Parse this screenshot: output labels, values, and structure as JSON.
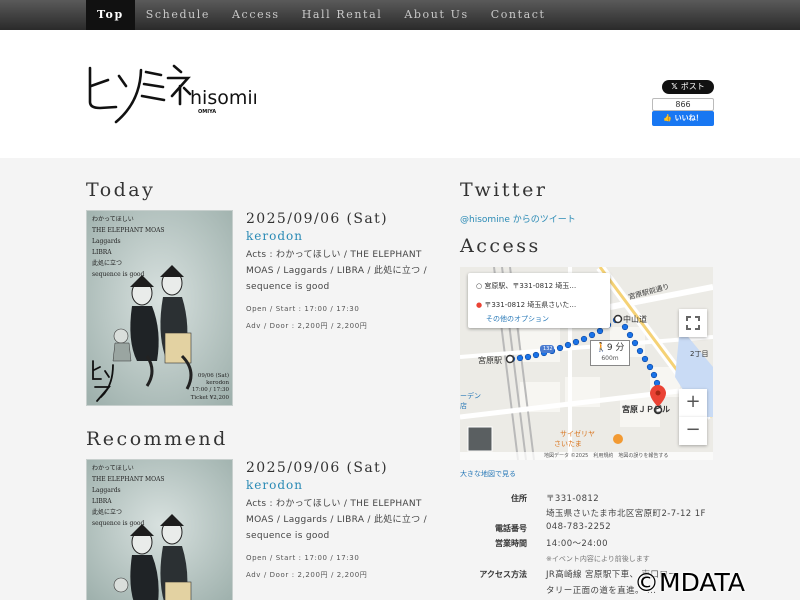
{
  "nav": {
    "items": [
      {
        "label": "Top",
        "active": true
      },
      {
        "label": "Schedule"
      },
      {
        "label": "Access"
      },
      {
        "label": "Hall Rental"
      },
      {
        "label": "About Us"
      },
      {
        "label": "Contact"
      }
    ]
  },
  "header": {
    "logo_text": "ヒソミネ",
    "logo_roman": "hisomine",
    "logo_sub": "OMIYA",
    "share_x_label": "ポスト",
    "fb_count": "866",
    "fb_like_label": "いいね！"
  },
  "today": {
    "title": "Today",
    "date": "2025/09/06 (Sat)",
    "name": "kerodon",
    "acts": "Acts : わかってほしい / THE ELEPHANT MOAS / Laggards / LIBRA / 此処に立つ / sequence is good",
    "open_start": "Open / Start : 17:00 / 17:30",
    "adv_door": "Adv / Door : 2,200円 / 2,200円",
    "flyer": {
      "lines": [
        "わかってほしい",
        "THE ELEPHANT MOAS",
        "Laggards",
        "LIBRA",
        "此処に立つ",
        "sequence is good"
      ],
      "footer": [
        "09/06 (Sat)",
        "kerodon",
        "17:00 / 17:30",
        "Ticket ¥2,200"
      ]
    }
  },
  "recommend": {
    "title": "Recommend",
    "date": "2025/09/06 (Sat)",
    "name": "kerodon",
    "acts": "Acts : わかってほしい / THE ELEPHANT MOAS / Laggards / LIBRA / 此処に立つ / sequence is good",
    "open_start": "Open / Start : 17:00 / 17:30",
    "adv_door": "Adv / Door : 2,200円 / 2,200円",
    "flyer": {
      "lines": [
        "わかってほしい",
        "THE ELEPHANT MOAS",
        "Laggards",
        "LIBRA",
        "此処に立つ",
        "sequence is good"
      ]
    }
  },
  "twitter": {
    "title": "Twitter",
    "link": "@hisomine からのツイート"
  },
  "access": {
    "title": "Access",
    "map": {
      "from": "宮原駅、〒331-0812 埼玉…",
      "to": "〒331-0812 埼玉県さいた…",
      "more_options": "その他のオプション",
      "walk_time": "9 分",
      "walk_distance": "600m",
      "labels": {
        "station": "宮原駅",
        "nakasendo": "中山道",
        "destination": "宮原ＪＰビル",
        "road": "宮原駅前通り",
        "chome": "2丁目",
        "saizeriya": "サイゼリヤ",
        "saizeriya2": "さいたま",
        "route_no": "132",
        "partial": "ーデン",
        "partial2": "店"
      },
      "zoom_in": "+",
      "zoom_out": "−",
      "footer": "地図データ ©2025　利用規約　地図の誤りを報告する"
    },
    "bigmap_link": "大きな地図で見る",
    "info": [
      {
        "label": "住所",
        "values": [
          "〒331-0812",
          "埼玉県さいたま市北区宮原町2-7-12 1F"
        ]
      },
      {
        "label": "電話番号",
        "values": [
          "048-783-2252"
        ]
      },
      {
        "label": "営業時間",
        "values": [
          "14:00〜24:00"
        ]
      },
      {
        "label": "アクセス方法",
        "values": [
          "JR高崎線 宮原駅下車、 東口ロー",
          "タリー正面の道を直進。 ..."
        ]
      }
    ],
    "hours_note": "※イベント内容により前後します"
  },
  "watermark": "©MDATA",
  "colors": {
    "link": "#2a8ab5",
    "nav_bg": "#2a2a2a",
    "route_blue": "#1a73e8",
    "pin_red": "#ea4335"
  }
}
